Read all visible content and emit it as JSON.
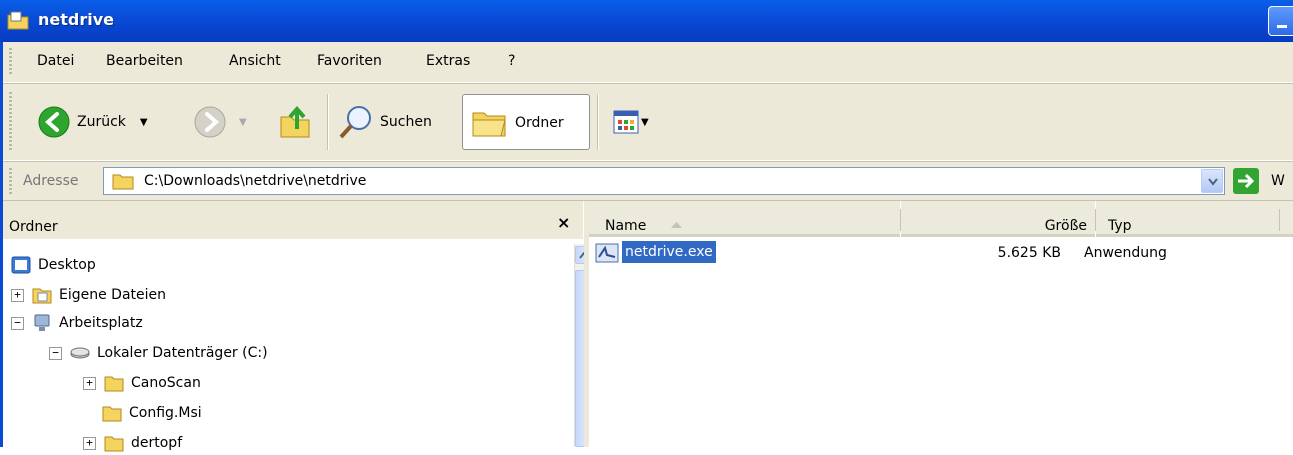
{
  "window": {
    "title": "netdrive"
  },
  "menu": [
    "Datei",
    "Bearbeiten",
    "Ansicht",
    "Favoriten",
    "Extras",
    "?"
  ],
  "toolbar": {
    "back_label": "Zurück",
    "search_label": "Suchen",
    "folders_label": "Ordner"
  },
  "address": {
    "label": "Adresse",
    "path": "C:\\Downloads\\netdrive\\netdrive",
    "go_label": "W"
  },
  "folders_pane": {
    "title": "Ordner",
    "close_glyph": "×",
    "tree": [
      {
        "label": "Desktop",
        "expander": ""
      },
      {
        "label": "Eigene Dateien",
        "expander": "+"
      },
      {
        "label": "Arbeitsplatz",
        "expander": "−"
      },
      {
        "label": "Lokaler Datenträger (C:)",
        "expander": "−"
      },
      {
        "label": "CanoScan",
        "expander": "+"
      },
      {
        "label": "Config.Msi",
        "expander": ""
      },
      {
        "label": "dertopf",
        "expander": "+"
      }
    ]
  },
  "file_list": {
    "columns": {
      "name": "Name",
      "size": "Größe",
      "type": "Typ"
    },
    "rows": [
      {
        "name": "netdrive.exe",
        "size": "5.625 KB",
        "type": "Anwendung",
        "selected": true
      }
    ]
  },
  "colors": {
    "titlebar": "#0a4bd6",
    "toolbar_bg": "#ece9d8",
    "selection": "#316ac5",
    "folder": "#f4d35e"
  }
}
